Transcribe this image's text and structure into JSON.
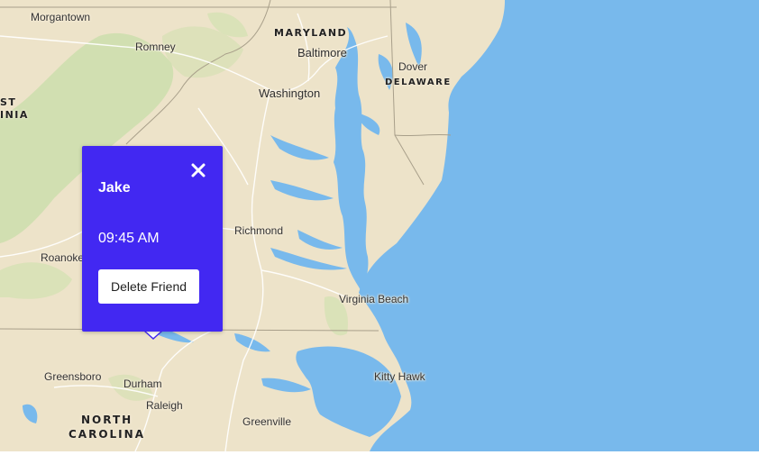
{
  "map": {
    "cities": [
      {
        "id": "morgantown",
        "label": "Morgantown"
      },
      {
        "id": "romney",
        "label": "Romney"
      },
      {
        "id": "baltimore",
        "label": "Baltimore"
      },
      {
        "id": "washington",
        "label": "Washington"
      },
      {
        "id": "dover",
        "label": "Dover"
      },
      {
        "id": "richmond",
        "label": "Richmond"
      },
      {
        "id": "roanoke",
        "label": "Roanoke"
      },
      {
        "id": "virginia-beach",
        "label": "Virginia Beach"
      },
      {
        "id": "greensboro",
        "label": "Greensboro"
      },
      {
        "id": "durham",
        "label": "Durham"
      },
      {
        "id": "raleigh",
        "label": "Raleigh"
      },
      {
        "id": "kitty-hawk",
        "label": "Kitty Hawk"
      },
      {
        "id": "greenville",
        "label": "Greenville"
      }
    ],
    "states": {
      "maryland": "MARYLAND",
      "delaware": "DELAWARE",
      "west_virginia_line1": "ST",
      "west_virginia_line2": "INIA",
      "north_carolina_line1": "NORTH",
      "north_carolina_line2": "CAROLINA"
    },
    "colors": {
      "land": "#ede3c9",
      "water": "#78b9ec",
      "forest": "#c9dca8",
      "popup": "#4228f2"
    }
  },
  "popup": {
    "close_icon": "close-icon",
    "name": "Jake",
    "time": "09:45 AM",
    "delete_label": "Delete Friend"
  }
}
